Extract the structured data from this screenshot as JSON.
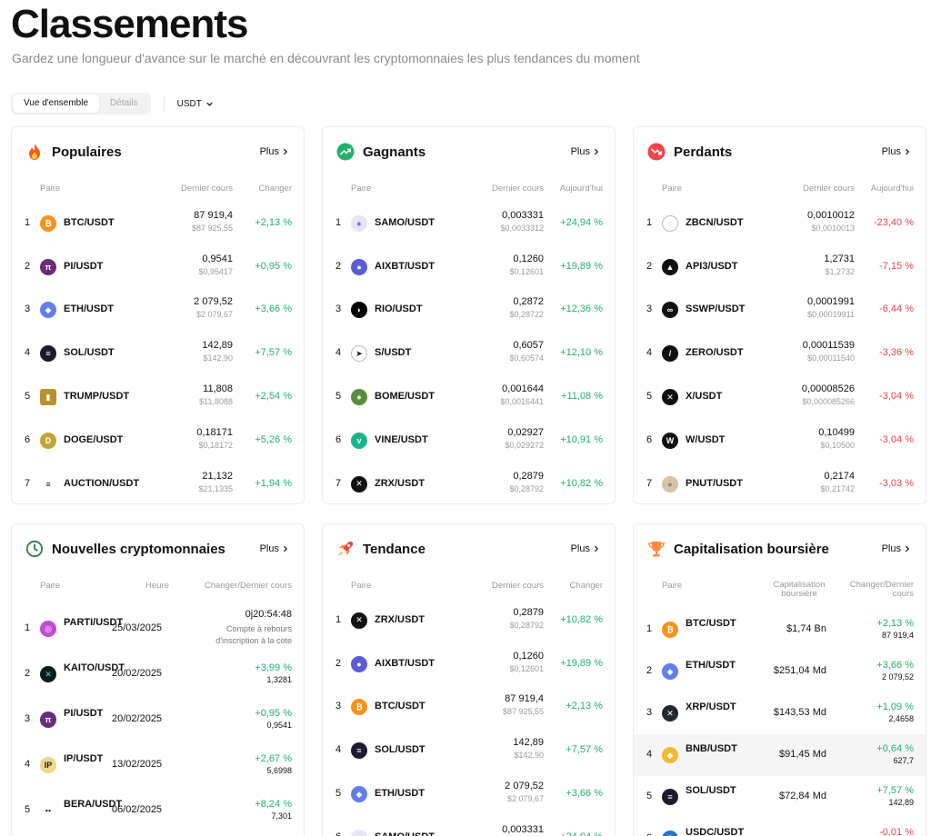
{
  "page": {
    "title": "Classements",
    "subtitle": "Gardez une longueur d'avance sur le marché en découvrant les cryptomonnaies les plus tendances du moment"
  },
  "toolbar": {
    "tab_overview": "Vue d'ensemble",
    "tab_details": "Détails",
    "currency": "USDT"
  },
  "colors": {
    "up": "#20b26c",
    "down": "#ef454a"
  },
  "cards": {
    "populaires": {
      "title": "Populaires",
      "more": "Plus",
      "h_pair": "Paire",
      "h_price": "Dernier cours",
      "h_change": "Changer",
      "rows": [
        {
          "rank": "1",
          "pair": "BTC/USDT",
          "price": "87 919,4",
          "sub": "$87 925,55",
          "change": "+2,13 %",
          "icon": "btc-icon"
        },
        {
          "rank": "2",
          "pair": "PI/USDT",
          "price": "0,9541",
          "sub": "$0,95417",
          "change": "+0,95 %",
          "icon": "pi-icon"
        },
        {
          "rank": "3",
          "pair": "ETH/USDT",
          "price": "2 079,52",
          "sub": "$2 079,67",
          "change": "+3,66 %",
          "icon": "eth-icon"
        },
        {
          "rank": "4",
          "pair": "SOL/USDT",
          "price": "142,89",
          "sub": "$142,90",
          "change": "+7,57 %",
          "icon": "sol-icon"
        },
        {
          "rank": "5",
          "pair": "TRUMP/USDT",
          "price": "11,808",
          "sub": "$11,8088",
          "change": "+2,54 %",
          "icon": "trump-icon"
        },
        {
          "rank": "6",
          "pair": "DOGE/USDT",
          "price": "0,18171",
          "sub": "$0,18172",
          "change": "+5,26 %",
          "icon": "doge-icon"
        },
        {
          "rank": "7",
          "pair": "AUCTION/USDT",
          "price": "21,132",
          "sub": "$21,1335",
          "change": "+1,94 %",
          "icon": "auction-icon"
        }
      ]
    },
    "gagnants": {
      "title": "Gagnants",
      "more": "Plus",
      "h_pair": "Paire",
      "h_price": "Dernier cours",
      "h_change": "Aujourd'hui",
      "rows": [
        {
          "rank": "1",
          "pair": "SAMO/USDT",
          "price": "0,003331",
          "sub": "$0,0033312",
          "change": "+24,94 %",
          "icon": "samo-icon"
        },
        {
          "rank": "2",
          "pair": "AIXBT/USDT",
          "price": "0,1260",
          "sub": "$0,12601",
          "change": "+19,89 %",
          "icon": "aixbt-icon"
        },
        {
          "rank": "3",
          "pair": "RIO/USDT",
          "price": "0,2872",
          "sub": "$0,28722",
          "change": "+12,36 %",
          "icon": "rio-icon"
        },
        {
          "rank": "4",
          "pair": "S/USDT",
          "price": "0,6057",
          "sub": "$0,60574",
          "change": "+12,10 %",
          "icon": "s-icon"
        },
        {
          "rank": "5",
          "pair": "BOME/USDT",
          "price": "0,001644",
          "sub": "$0,0016441",
          "change": "+11,08 %",
          "icon": "bome-icon"
        },
        {
          "rank": "6",
          "pair": "VINE/USDT",
          "price": "0,02927",
          "sub": "$0,029272",
          "change": "+10,91 %",
          "icon": "vine-icon"
        },
        {
          "rank": "7",
          "pair": "ZRX/USDT",
          "price": "0,2879",
          "sub": "$0,28792",
          "change": "+10,82 %",
          "icon": "zrx-icon"
        }
      ]
    },
    "perdants": {
      "title": "Perdants",
      "more": "Plus",
      "h_pair": "Paire",
      "h_price": "Dernier cours",
      "h_change": "Aujourd'hui",
      "rows": [
        {
          "rank": "1",
          "pair": "ZBCN/USDT",
          "price": "0,0010012",
          "sub": "$0,0010013",
          "change": "-23,40 %",
          "icon": "zbcn-icon"
        },
        {
          "rank": "2",
          "pair": "API3/USDT",
          "price": "1,2731",
          "sub": "$1,2732",
          "change": "-7,15 %",
          "icon": "api3-icon"
        },
        {
          "rank": "3",
          "pair": "SSWP/USDT",
          "price": "0,0001991",
          "sub": "$0,00019911",
          "change": "-6,44 %",
          "icon": "sswp-icon"
        },
        {
          "rank": "4",
          "pair": "ZERO/USDT",
          "price": "0,00011539",
          "sub": "$0,00011540",
          "change": "-3,36 %",
          "icon": "zero-icon"
        },
        {
          "rank": "5",
          "pair": "X/USDT",
          "price": "0,00008526",
          "sub": "$0,000085266",
          "change": "-3,04 %",
          "icon": "x-icon"
        },
        {
          "rank": "6",
          "pair": "W/USDT",
          "price": "0,10499",
          "sub": "$0,10500",
          "change": "-3,04 %",
          "icon": "w-icon"
        },
        {
          "rank": "7",
          "pair": "PNUT/USDT",
          "price": "0,2174",
          "sub": "$0,21742",
          "change": "-3,03 %",
          "icon": "pnut-icon"
        }
      ]
    },
    "nouvelles": {
      "title": "Nouvelles cryptomonnaies",
      "more": "Plus",
      "h_pair": "Paire",
      "h_time": "Heure",
      "h_change": "Changer/Dernier cours",
      "rows": [
        {
          "rank": "1",
          "pair": "PARTI/USDT",
          "date": "25/03/2025",
          "change": "0j20:54:48",
          "sub": "Compte à rebours d'inscription à la cote",
          "icon": "parti-icon"
        },
        {
          "rank": "2",
          "pair": "KAITO/USDT",
          "date": "20/02/2025",
          "change": "+3,99 %",
          "sub": "1,3281",
          "icon": "kaito-icon"
        },
        {
          "rank": "3",
          "pair": "PI/USDT",
          "date": "20/02/2025",
          "change": "+0,95 %",
          "sub": "0,9541",
          "icon": "pi-icon"
        },
        {
          "rank": "4",
          "pair": "IP/USDT",
          "date": "13/02/2025",
          "change": "+2,67 %",
          "sub": "5,6998",
          "icon": "ip-icon"
        },
        {
          "rank": "5",
          "pair": "BERA/USDT",
          "date": "06/02/2025",
          "change": "+8,24 %",
          "sub": "7,301",
          "icon": "bera-icon"
        }
      ]
    },
    "tendance": {
      "title": "Tendance",
      "more": "Plus",
      "h_pair": "Paire",
      "h_price": "Dernier cours",
      "h_change": "Changer",
      "rows": [
        {
          "rank": "1",
          "pair": "ZRX/USDT",
          "price": "0,2879",
          "sub": "$0,28792",
          "change": "+10,82 %",
          "icon": "zrx-icon"
        },
        {
          "rank": "2",
          "pair": "AIXBT/USDT",
          "price": "0,1260",
          "sub": "$0,12601",
          "change": "+19,89 %",
          "icon": "aixbt-icon"
        },
        {
          "rank": "3",
          "pair": "BTC/USDT",
          "price": "87 919,4",
          "sub": "$87 925,55",
          "change": "+2,13 %",
          "icon": "btc-icon"
        },
        {
          "rank": "4",
          "pair": "SOL/USDT",
          "price": "142,89",
          "sub": "$142,90",
          "change": "+7,57 %",
          "icon": "sol-icon"
        },
        {
          "rank": "5",
          "pair": "ETH/USDT",
          "price": "2 079,52",
          "sub": "$2 079,67",
          "change": "+3,66 %",
          "icon": "eth-icon"
        },
        {
          "rank": "6",
          "pair": "SAMO/USDT",
          "price": "0,003331",
          "sub": "",
          "change": "+24,94 %",
          "icon": "samo-icon"
        }
      ]
    },
    "capitalisation": {
      "title": "Capitalisation boursière",
      "more": "Plus",
      "h_pair": "Paire",
      "h_cap": "Capitalisation boursière",
      "h_change": "Changer/Dernier cours",
      "rows": [
        {
          "rank": "1",
          "pair": "BTC/USDT",
          "cap": "$1,74 Bn",
          "change": "+2,13 %",
          "sub": "87 919,4",
          "icon": "btc-icon"
        },
        {
          "rank": "2",
          "pair": "ETH/USDT",
          "cap": "$251,04 Md",
          "change": "+3,66 %",
          "sub": "2 079,52",
          "icon": "eth-icon"
        },
        {
          "rank": "3",
          "pair": "XRP/USDT",
          "cap": "$143,53 Md",
          "change": "+1,09 %",
          "sub": "2,4658",
          "icon": "xrp-icon"
        },
        {
          "rank": "4",
          "pair": "BNB/USDT",
          "cap": "$91,45 Md",
          "change": "+0,64 %",
          "sub": "627,7",
          "icon": "bnb-icon"
        },
        {
          "rank": "5",
          "pair": "SOL/USDT",
          "cap": "$72,84 Md",
          "change": "+7,57 %",
          "sub": "142,89",
          "icon": "sol-icon"
        },
        {
          "rank": "6",
          "pair": "USDC/USDT",
          "cap": "",
          "change": "-0,01 %",
          "sub": "",
          "icon": "usdc-icon"
        }
      ]
    }
  }
}
